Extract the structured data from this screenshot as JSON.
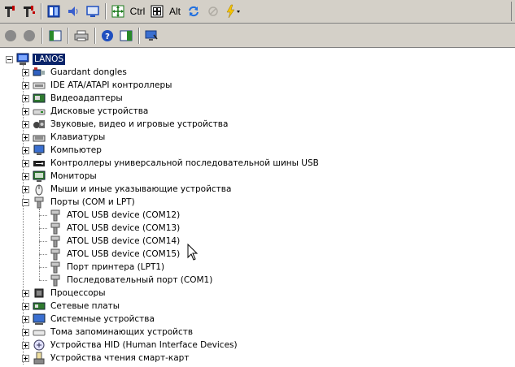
{
  "toolbar": {
    "ctrl_label": "Ctrl",
    "alt_label": "Alt"
  },
  "tree": {
    "root": "LANOS",
    "categories": [
      {
        "label": "Guardant dongles",
        "icon": "dongle-icon"
      },
      {
        "label": "IDE ATA/ATAPI контроллеры",
        "icon": "ide-controller-icon"
      },
      {
        "label": "Видеоадаптеры",
        "icon": "video-adapter-icon"
      },
      {
        "label": "Дисковые устройства",
        "icon": "disk-drive-icon"
      },
      {
        "label": "Звуковые, видео и игровые устройства",
        "icon": "sound-icon"
      },
      {
        "label": "Клавиатуры",
        "icon": "keyboard-icon"
      },
      {
        "label": "Компьютер",
        "icon": "computer-icon"
      },
      {
        "label": "Контроллеры универсальной последовательной шины USB",
        "icon": "usb-icon"
      },
      {
        "label": "Мониторы",
        "icon": "monitor-icon"
      },
      {
        "label": "Мыши и иные указывающие устройства",
        "icon": "mouse-icon"
      },
      {
        "label": "Порты (COM и LPT)",
        "icon": "port-icon",
        "expanded": true
      }
    ],
    "ports": [
      "ATOL USB device (COM12)",
      "ATOL USB device (COM13)",
      "ATOL USB device (COM14)",
      "ATOL USB device (COM15)",
      "Порт принтера (LPT1)",
      "Последовательный порт (COM1)"
    ],
    "categories_after": [
      {
        "label": "Процессоры",
        "icon": "processor-icon"
      },
      {
        "label": "Сетевые платы",
        "icon": "network-card-icon"
      },
      {
        "label": "Системные устройства",
        "icon": "system-device-icon"
      },
      {
        "label": "Тома запоминающих устройств",
        "icon": "storage-volume-icon"
      },
      {
        "label": "Устройства HID (Human Interface Devices)",
        "icon": "hid-icon"
      },
      {
        "label": "Устройства чтения смарт-карт",
        "icon": "smartcard-reader-icon"
      }
    ]
  }
}
